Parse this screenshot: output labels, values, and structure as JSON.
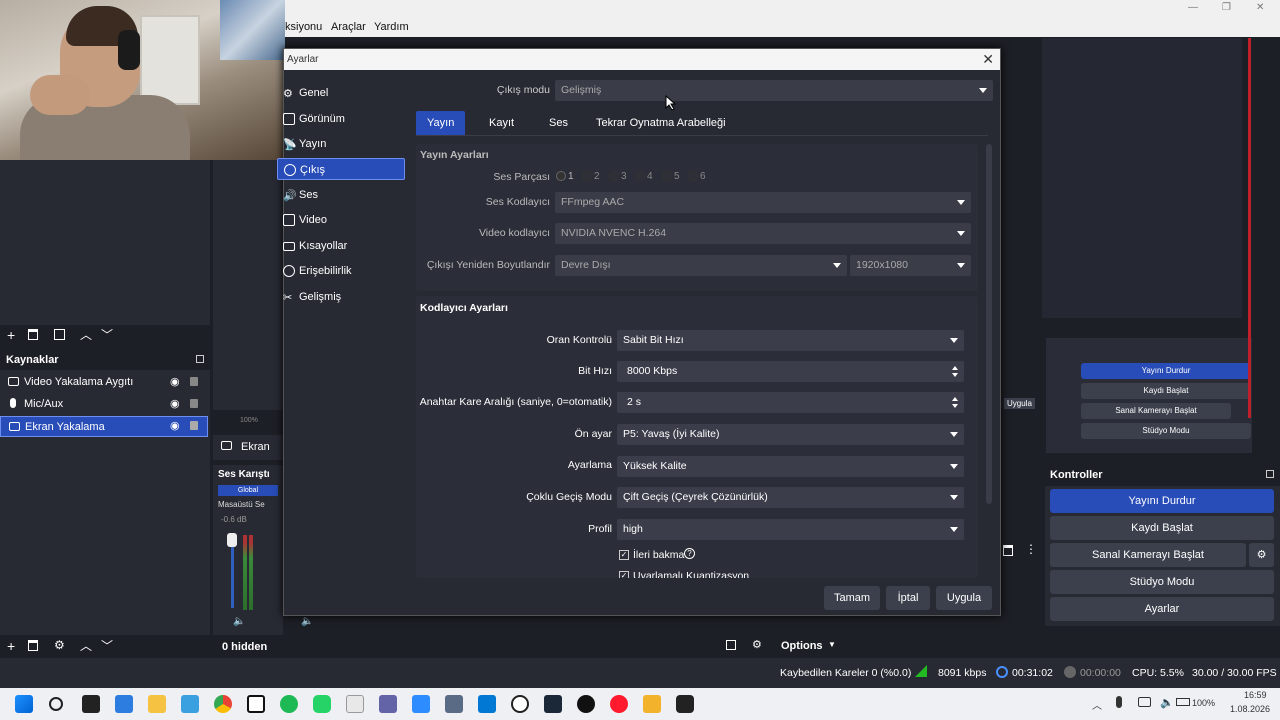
{
  "menu": {
    "items": [
      "ksiyonu",
      "Araçlar",
      "Yardım"
    ]
  },
  "dialog": {
    "title": "Ayarlar",
    "close": "✕",
    "nav": [
      "Genel",
      "Görünüm",
      "Yayın",
      "Çıkış",
      "Ses",
      "Video",
      "Kısayollar",
      "Erişebilirlik",
      "Gelişmiş"
    ],
    "output_mode_label": "Çıkış modu",
    "output_mode_value": "Gelişmiş",
    "tabs": [
      "Yayın",
      "Kayıt",
      "Ses",
      "Tekrar Oynatma Arabelleği"
    ],
    "stream_section": "Yayın Ayarları",
    "audio_track_label": "Ses Parçası",
    "audio_tracks": [
      "1",
      "2",
      "3",
      "4",
      "5",
      "6"
    ],
    "audio_encoder_label": "Ses Kodlayıcı",
    "audio_encoder_value": "FFmpeg AAC",
    "video_encoder_label": "Video kodlayıcı",
    "video_encoder_value": "NVIDIA NVENC H.264",
    "rescale_label": "Çıkışı Yeniden Boyutlandır",
    "rescale_value": "Devre Dışı",
    "rescale_res": "1920x1080",
    "encoder_section": "Kodlayıcı Ayarları",
    "rate_control_label": "Oran Kontrolü",
    "rate_control_value": "Sabit Bit Hızı",
    "bitrate_label": "Bit Hızı",
    "bitrate_value": "8000 Kbps",
    "keyframe_label": "Anahtar Kare Aralığı (saniye, 0=otomatik)",
    "keyframe_value": "2 s",
    "preset_label": "Ön ayar",
    "preset_value": "P5: Yavaş (İyi Kalite)",
    "tuning_label": "Ayarlama",
    "tuning_value": "Yüksek Kalite",
    "multipass_label": "Çoklu Geçiş Modu",
    "multipass_value": "Çift Geçiş (Çeyrek Çözünürlük)",
    "profile_label": "Profil",
    "profile_value": "high",
    "lookahead_label": "İleri bakma",
    "aq_label": "Uyarlamalı Kuantizasyon",
    "ok": "Tamam",
    "cancel": "İptal",
    "apply": "Uygula"
  },
  "sources": {
    "header": "Kaynaklar",
    "items": [
      "Video Yakalama Aygıtı",
      "Mic/Aux",
      "Ekran Yakalama"
    ],
    "hidden": "0 hidden"
  },
  "mixer": {
    "preview_label": "Ekran",
    "zoom": "100%",
    "title": "Ses Karıştı",
    "global": "Global",
    "track": "Masaüstü Se",
    "db": "-0.6 dB"
  },
  "controls": {
    "header": "Kontroller",
    "buttons": [
      "Yayını Durdur",
      "Kaydı Başlat",
      "Sanal Kamerayı Başlat",
      "Stüdyo Modu",
      "Ayarlar"
    ],
    "apply_small": "Uygula",
    "options": "Options"
  },
  "status": {
    "dropped": "Kaybedilen Kareler 0 (%0.0)",
    "kbps": "8091 kbps",
    "live_time": "00:31:02",
    "rec_time": "00:00:00",
    "cpu": "CPU: 5.5%",
    "fps": "30.00 / 30.00 FPS"
  },
  "taskbar": {
    "battery": "100%",
    "time": "16:59",
    "date": "1.08.2026"
  },
  "colors": {
    "accent": "#284cb8",
    "panel": "#272a33",
    "bg": "#1d1f26"
  }
}
